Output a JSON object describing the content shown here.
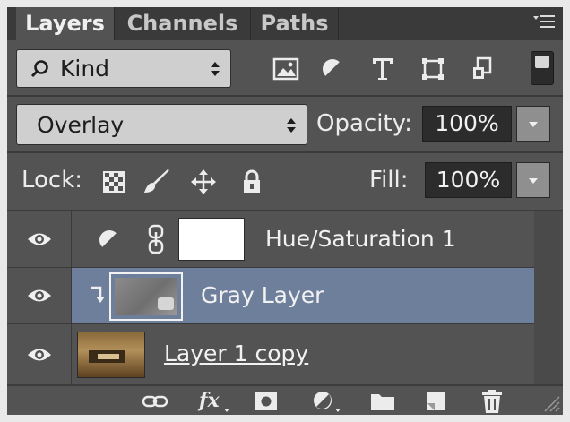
{
  "tabs": [
    {
      "label": "Layers",
      "active": true
    },
    {
      "label": "Channels",
      "active": false
    },
    {
      "label": "Paths",
      "active": false
    }
  ],
  "panel_menu_icon": "panel-menu-icon",
  "filter": {
    "kind_label": "Kind",
    "filter_icons": [
      "pixel-layer-filter-icon",
      "adjustment-layer-filter-icon",
      "type-layer-filter-icon",
      "shape-layer-filter-icon",
      "smart-object-filter-icon"
    ]
  },
  "blend": {
    "mode": "Overlay",
    "opacity_label": "Opacity:",
    "opacity_value": "100%"
  },
  "lock": {
    "lock_label": "Lock:",
    "lock_icons": [
      "lock-transparent-pixels-icon",
      "lock-image-pixels-icon",
      "lock-position-icon",
      "lock-all-icon"
    ],
    "fill_label": "Fill:",
    "fill_value": "100%"
  },
  "layers": [
    {
      "name": "Hue/Saturation 1",
      "type": "adjustment",
      "visible": true,
      "selected": false
    },
    {
      "name": "Gray Layer",
      "type": "pixel",
      "visible": true,
      "selected": true,
      "clipped": true
    },
    {
      "name": "Layer 1 copy",
      "type": "pixel",
      "visible": true,
      "selected": false
    }
  ],
  "bottom_icons": [
    "link-layers-icon",
    "layer-style-icon",
    "add-mask-icon",
    "new-adjustment-layer-icon",
    "new-group-icon",
    "new-layer-icon",
    "delete-layer-icon"
  ],
  "colors": {
    "panel_bg": "#535353",
    "selected_row": "#6e7f9c",
    "tab_bar": "#3a3a3a"
  }
}
